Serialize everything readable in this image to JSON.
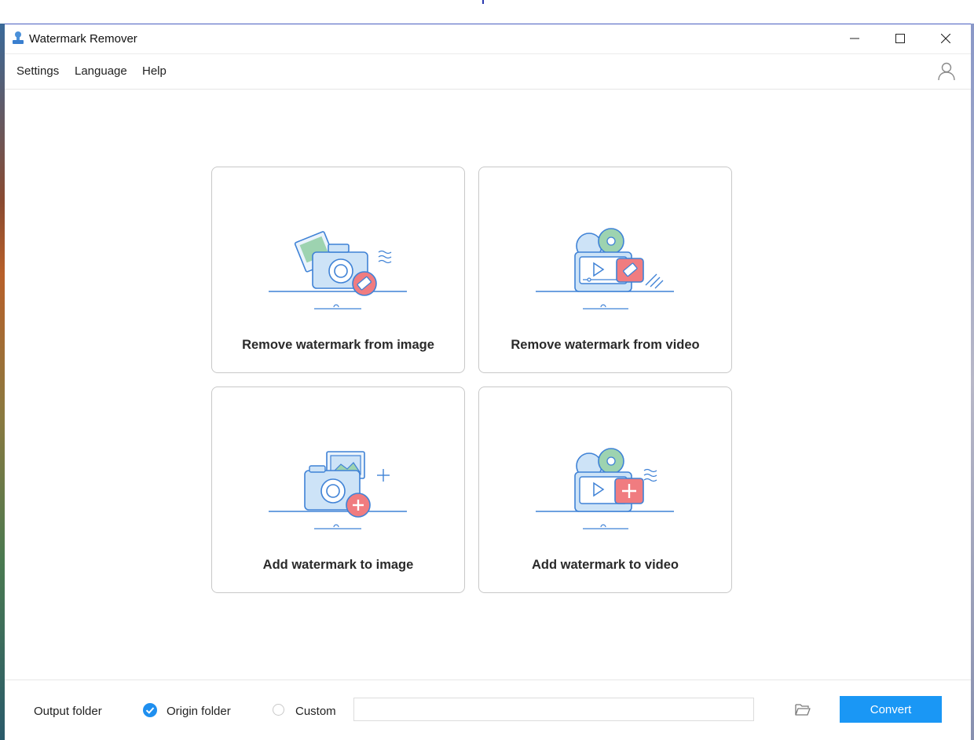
{
  "window": {
    "title": "Watermark Remover",
    "controls": [
      "minimize-icon",
      "maximize-icon",
      "close-icon"
    ]
  },
  "menu": {
    "items": [
      "Settings",
      "Language",
      "Help"
    ],
    "account_icon": "user-icon"
  },
  "cards": [
    {
      "label": "Remove watermark from image",
      "icon": "camera-eraser-icon"
    },
    {
      "label": "Remove watermark from video",
      "icon": "video-eraser-icon"
    },
    {
      "label": "Add watermark to image",
      "icon": "camera-add-icon"
    },
    {
      "label": "Add watermark to video",
      "icon": "video-add-icon"
    }
  ],
  "output": {
    "label": "Output folder",
    "options": [
      {
        "label": "Origin folder",
        "selected": true
      },
      {
        "label": "Custom",
        "selected": false
      }
    ],
    "path_value": "",
    "folder_icon": "folder-open-icon",
    "convert_label": "Convert"
  },
  "colors": {
    "accent": "#1a97f5",
    "illustration_line": "#3f82d6",
    "illustration_fill": "#cde3f7",
    "badge_red": "#f07c80",
    "green": "#9dd3b0"
  }
}
